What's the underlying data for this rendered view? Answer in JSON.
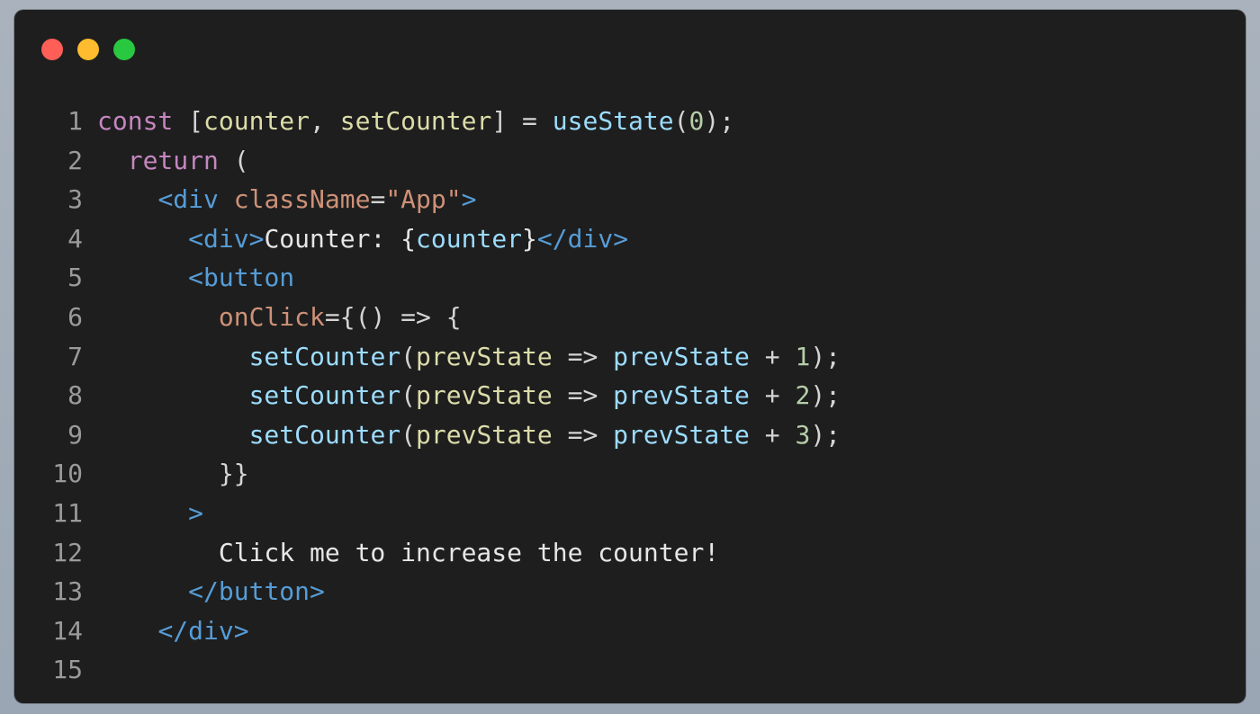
{
  "window": {
    "controls": [
      {
        "name": "close",
        "color": "#ff5f57"
      },
      {
        "name": "minimize",
        "color": "#febc2e"
      },
      {
        "name": "zoom",
        "color": "#28c840"
      }
    ]
  },
  "colors": {
    "keyword": "#c586c0",
    "plain": "#d4d4d4",
    "func": "#dcdcaa",
    "var": "#9cdcfe",
    "number": "#b5cea8",
    "tag": "#569cd6",
    "attr": "#ce9178",
    "string": "#ce9178",
    "text": "#e6e6e6",
    "line_number": "#9a9a9a"
  },
  "code_lines": [
    {
      "number": "1",
      "tokens": [
        {
          "t": "const",
          "c": "keyword"
        },
        {
          "t": " [",
          "c": "plain"
        },
        {
          "t": "counter",
          "c": "func"
        },
        {
          "t": ", ",
          "c": "plain"
        },
        {
          "t": "setCounter",
          "c": "func"
        },
        {
          "t": "] = ",
          "c": "plain"
        },
        {
          "t": "useState",
          "c": "var"
        },
        {
          "t": "(",
          "c": "plain"
        },
        {
          "t": "0",
          "c": "number"
        },
        {
          "t": ");",
          "c": "plain"
        }
      ]
    },
    {
      "number": "2",
      "tokens": [
        {
          "t": "  ",
          "c": "plain"
        },
        {
          "t": "return",
          "c": "keyword"
        },
        {
          "t": " (",
          "c": "plain"
        }
      ]
    },
    {
      "number": "3",
      "tokens": [
        {
          "t": "    ",
          "c": "plain"
        },
        {
          "t": "<div",
          "c": "tag"
        },
        {
          "t": " ",
          "c": "plain"
        },
        {
          "t": "className",
          "c": "attr"
        },
        {
          "t": "=",
          "c": "plain"
        },
        {
          "t": "\"App\"",
          "c": "string"
        },
        {
          "t": ">",
          "c": "tag"
        }
      ]
    },
    {
      "number": "4",
      "tokens": [
        {
          "t": "      ",
          "c": "plain"
        },
        {
          "t": "<div>",
          "c": "tag"
        },
        {
          "t": "Counter: {",
          "c": "text"
        },
        {
          "t": "counter",
          "c": "var"
        },
        {
          "t": "}",
          "c": "text"
        },
        {
          "t": "</div>",
          "c": "tag"
        }
      ]
    },
    {
      "number": "5",
      "tokens": [
        {
          "t": "      ",
          "c": "plain"
        },
        {
          "t": "<button",
          "c": "tag"
        }
      ]
    },
    {
      "number": "6",
      "tokens": [
        {
          "t": "        ",
          "c": "plain"
        },
        {
          "t": "onClick",
          "c": "attr"
        },
        {
          "t": "={() => {",
          "c": "plain"
        }
      ]
    },
    {
      "number": "7",
      "tokens": [
        {
          "t": "          ",
          "c": "plain"
        },
        {
          "t": "setCounter",
          "c": "var"
        },
        {
          "t": "(",
          "c": "plain"
        },
        {
          "t": "prevState",
          "c": "func"
        },
        {
          "t": " => ",
          "c": "plain"
        },
        {
          "t": "prevState",
          "c": "var"
        },
        {
          "t": " + ",
          "c": "plain"
        },
        {
          "t": "1",
          "c": "number"
        },
        {
          "t": ");",
          "c": "plain"
        }
      ]
    },
    {
      "number": "8",
      "tokens": [
        {
          "t": "          ",
          "c": "plain"
        },
        {
          "t": "setCounter",
          "c": "var"
        },
        {
          "t": "(",
          "c": "plain"
        },
        {
          "t": "prevState",
          "c": "func"
        },
        {
          "t": " => ",
          "c": "plain"
        },
        {
          "t": "prevState",
          "c": "var"
        },
        {
          "t": " + ",
          "c": "plain"
        },
        {
          "t": "2",
          "c": "number"
        },
        {
          "t": ");",
          "c": "plain"
        }
      ]
    },
    {
      "number": "9",
      "tokens": [
        {
          "t": "          ",
          "c": "plain"
        },
        {
          "t": "setCounter",
          "c": "var"
        },
        {
          "t": "(",
          "c": "plain"
        },
        {
          "t": "prevState",
          "c": "func"
        },
        {
          "t": " => ",
          "c": "plain"
        },
        {
          "t": "prevState",
          "c": "var"
        },
        {
          "t": " + ",
          "c": "plain"
        },
        {
          "t": "3",
          "c": "number"
        },
        {
          "t": ");",
          "c": "plain"
        }
      ]
    },
    {
      "number": "10",
      "tokens": [
        {
          "t": "        ",
          "c": "plain"
        },
        {
          "t": "}}",
          "c": "plain"
        }
      ]
    },
    {
      "number": "11",
      "tokens": [
        {
          "t": "      ",
          "c": "plain"
        },
        {
          "t": ">",
          "c": "tag"
        }
      ]
    },
    {
      "number": "12",
      "tokens": [
        {
          "t": "        ",
          "c": "plain"
        },
        {
          "t": "Click me to increase the counter!",
          "c": "text"
        }
      ]
    },
    {
      "number": "13",
      "tokens": [
        {
          "t": "      ",
          "c": "plain"
        },
        {
          "t": "</button>",
          "c": "tag"
        }
      ]
    },
    {
      "number": "14",
      "tokens": [
        {
          "t": "    ",
          "c": "plain"
        },
        {
          "t": "</div>",
          "c": "tag"
        }
      ]
    },
    {
      "number": "15",
      "tokens": []
    }
  ]
}
